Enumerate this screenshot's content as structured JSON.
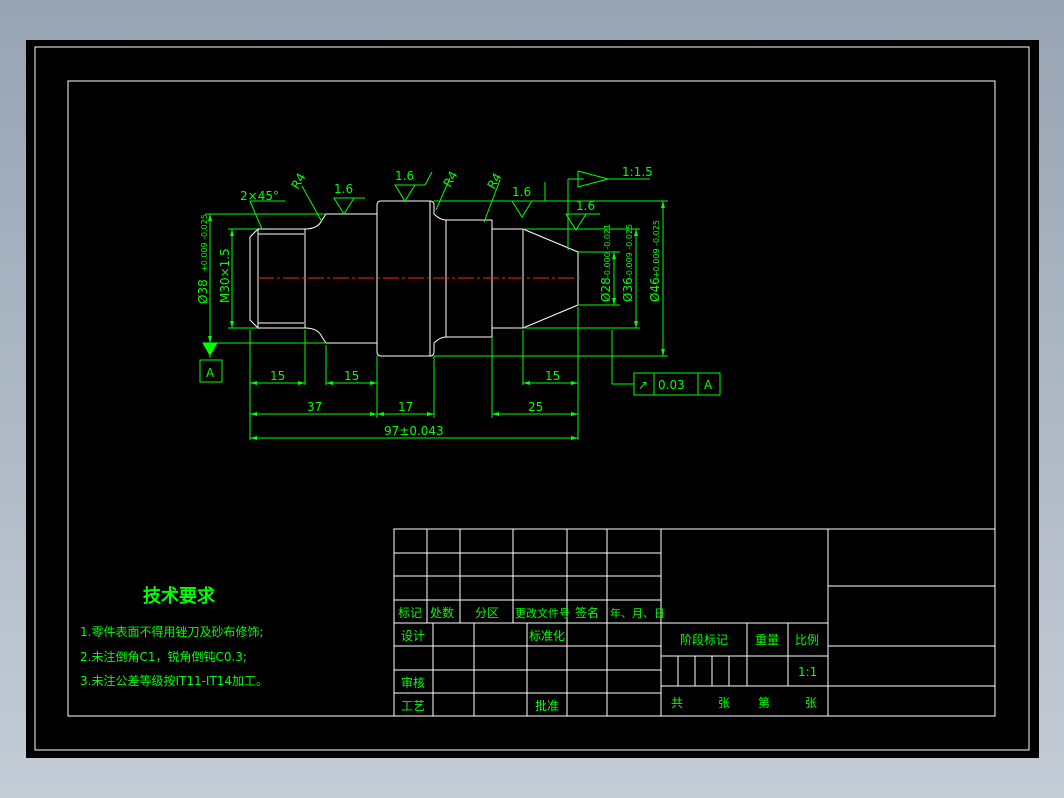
{
  "drawing": {
    "roughness": [
      "1.6",
      "1.6",
      "1.6",
      "1.6"
    ],
    "radius_labels": [
      "R4",
      "R4",
      "R4"
    ],
    "chamfer": "2×45°",
    "taper_ratio": "1:1.5",
    "datum": "A",
    "runout": {
      "symbol": "↗",
      "value": "0.03",
      "datum": "A"
    },
    "diameters": {
      "left": "Ø38",
      "left_tol": "+0.009 -0.025",
      "thread": "M30×1.5",
      "d28": "Ø28",
      "d28_tol": "-0.000 -0.021",
      "d36": "Ø36",
      "d36_tol": "-0.009 -0.025",
      "d46": "Ø46",
      "d46_tol": "+0.009 -0.025"
    },
    "dims": {
      "d15a": "15",
      "d15b": "15",
      "d15c": "15",
      "d37": "37",
      "d17": "17",
      "d25": "25",
      "total": "97±0.043"
    }
  },
  "tech_requirements": {
    "title": "技术要求",
    "items": [
      "1.零件表面不得用锉刀及砂布修饰;",
      "2.未注倒角C1，锐角倒钝C0.3;",
      "3.未注公差等级按IT11-IT14加工。"
    ]
  },
  "title_block": {
    "header": [
      "标记",
      "处数",
      "分区",
      "更改文件号",
      "签名",
      "年、月、日"
    ],
    "design": "设计",
    "standardize": "标准化",
    "review": "审核",
    "process": "工艺",
    "approve": "批准",
    "stage_mark": "阶段标记",
    "weight": "重量",
    "scale_label": "比例",
    "scale_value": "1:1",
    "total_sheets": "共",
    "sheet_unit1": "张",
    "sheet_no": "第",
    "sheet_unit2": "张"
  },
  "colors": {
    "background": "#000000",
    "frame": "#ffffff",
    "dimension": "#00ff00",
    "centerline": "#ff0000"
  }
}
